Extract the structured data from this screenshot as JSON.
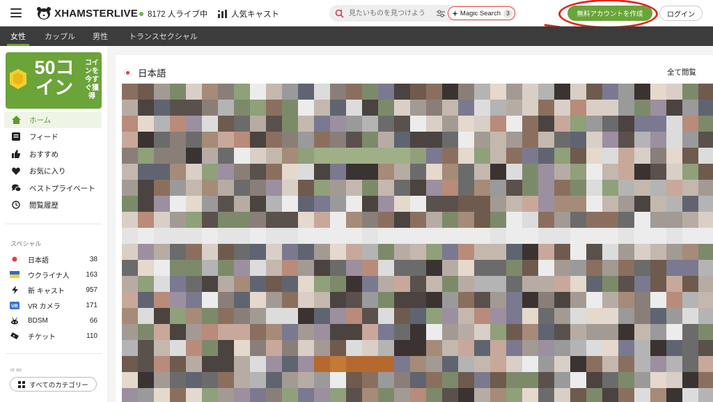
{
  "header": {
    "brand": "XHAMSTERLIVE",
    "online_count": "8172 人ライブ中",
    "popular_label": "人気キャスト",
    "search_placeholder": "見たいものを見つけよう",
    "magic_search_label": "Magic Search",
    "magic_search_count": "3",
    "signup_label": "無料アカウントを作成",
    "login_label": "ログイン",
    "accent_color": "#6ba439",
    "annotation_color": "#e0281d"
  },
  "tabs": [
    {
      "label": "女性",
      "active": true
    },
    {
      "label": "カップル",
      "active": false
    },
    {
      "label": "男性",
      "active": false
    },
    {
      "label": "トランスセクシャル",
      "active": false
    }
  ],
  "promo": {
    "big": "50コイン",
    "small": "コインを今すぐ獲得"
  },
  "sidebar": {
    "nav": [
      {
        "label": "ホーム",
        "icon": "home-icon",
        "active": true
      },
      {
        "label": "フィード",
        "icon": "feed-icon",
        "active": false
      },
      {
        "label": "おすすめ",
        "icon": "thumbs-up-icon",
        "active": false
      },
      {
        "label": "お気に入り",
        "icon": "heart-icon",
        "active": false
      },
      {
        "label": "ベストプライベート",
        "icon": "chat-bubbles-icon",
        "active": false
      },
      {
        "label": "閲覧履歴",
        "icon": "history-icon",
        "active": false
      }
    ],
    "special_title": "スペシャル",
    "special": [
      {
        "label": "日本語",
        "count": "38",
        "icon": "japan-flag-icon"
      },
      {
        "label": "ウクライナ人",
        "count": "163",
        "icon": "ukraine-flag-icon"
      },
      {
        "label": "新 キャスト",
        "count": "957",
        "icon": "lightning-icon"
      },
      {
        "label": "VR カメラ",
        "count": "171",
        "icon": "vr-icon"
      },
      {
        "label": "BDSM",
        "count": "66",
        "icon": "bunny-mask-icon"
      },
      {
        "label": "チケット",
        "count": "110",
        "icon": "ticket-icon"
      }
    ],
    "more_label": "or ao",
    "all_categories_label": "すべてのカテゴリー"
  },
  "content": {
    "section_title": "日本語",
    "view_all_label": "全て閲覧"
  }
}
